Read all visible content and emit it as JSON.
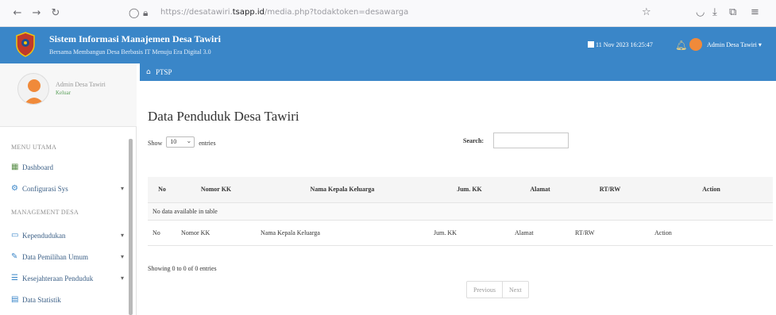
{
  "browser": {
    "url_prefix": "https://desatawiri.",
    "url_domain": "tsapp.id",
    "url_suffix": "/media.php?todaktoken=desawarga"
  },
  "header": {
    "title": "Sistem Informasi Manajemen Desa Tawiri",
    "subtitle": "Bersama Membangun Desa Berbasis IT Menuju Era Digital 3.0",
    "datetime": "11 Nov 2023 16:25:47",
    "user": "Admin Desa Tawiri ▾"
  },
  "sidebar": {
    "profile_name": "Admin Desa Tawiri",
    "profile_status": "Keluar",
    "section_main": "MENU UTAMA",
    "section_manage": "MANAGEMENT DESA",
    "items": [
      {
        "label": "Dashboard",
        "icon": "dashboard-icon"
      },
      {
        "label": "Configurasi Sys",
        "icon": "cogs-icon"
      },
      {
        "label": "Kependudukan",
        "icon": "id-card-icon"
      },
      {
        "label": "Data Pemilihan Umum",
        "icon": "edit-icon"
      },
      {
        "label": "Kesejahteraan Penduduk",
        "icon": "list-icon"
      },
      {
        "label": "Data Statistik",
        "icon": "chart-icon"
      }
    ]
  },
  "breadcrumb": {
    "label": "PTSP"
  },
  "main": {
    "page_title": "Data Penduduk Desa Tawiri",
    "show_label": "Show",
    "entries_value": "10",
    "entries_label": "entries",
    "search_label": "Search:",
    "search_value": "",
    "columns": [
      "No",
      "Nomor KK",
      "Nama Kepala Keluarga",
      "Jum. KK",
      "Alamat",
      "RT/RW",
      "Action"
    ],
    "empty_message": "No data available in table",
    "info": "Showing 0 to 0 of 0 entries",
    "prev_label": "Previous",
    "next_label": "Next"
  },
  "colors": {
    "header_blue": "#3a86c8",
    "sidebar_link": "#3b5f86",
    "avatar_orange": "#f08a3a"
  }
}
